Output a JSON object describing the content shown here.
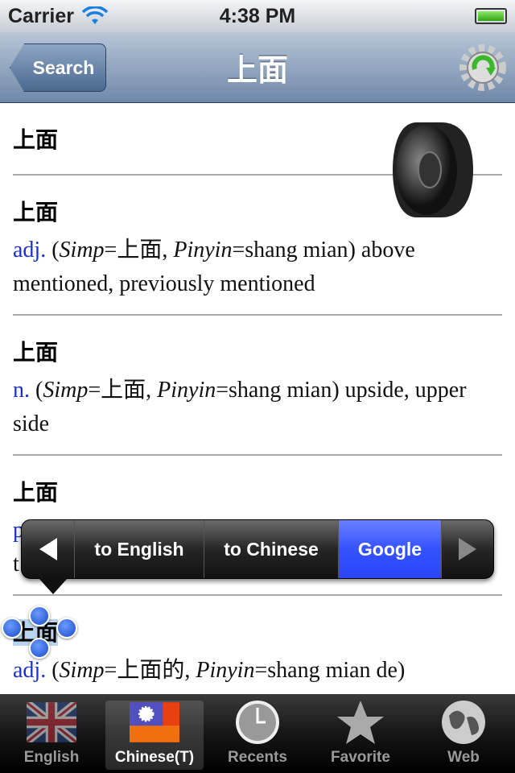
{
  "status": {
    "carrier": "Carrier",
    "time": "4:38 PM"
  },
  "nav": {
    "back_label": "Search",
    "title": "上面"
  },
  "entries": [
    {
      "headword": "上面"
    },
    {
      "headword": "上面",
      "pos": "adj.",
      "simp_label": "Simp",
      "simp": "上面",
      "pinyin_label": "Pinyin",
      "pinyin": "shang mian",
      "gloss": "above mentioned, previously mentioned"
    },
    {
      "headword": "上面",
      "pos": "n.",
      "simp_label": "Simp",
      "simp": "上面",
      "pinyin_label": "Pinyin",
      "pinyin": "shang mian",
      "gloss": "upside, upper side"
    },
    {
      "headword": "上面",
      "line1_fragment": "p",
      "line2_fragment": "t"
    },
    {
      "headword": "上面",
      "pos": "adj.",
      "simp_label": "Simp",
      "simp": "上面的",
      "pinyin_label": "Pinyin",
      "pinyin": "shang mian de"
    }
  ],
  "menu": {
    "items": [
      "to English",
      "to Chinese",
      "Google"
    ],
    "selected": "Google",
    "selected_color": "#3552ff"
  },
  "tabbar": {
    "active": "Chinese(T)",
    "tabs": [
      {
        "label": "English",
        "icon": "uk-flag-icon"
      },
      {
        "label": "Chinese(T)",
        "icon": "taiwan-flag-icon"
      },
      {
        "label": "Recents",
        "icon": "clock-icon"
      },
      {
        "label": "Favorite",
        "icon": "star-icon"
      },
      {
        "label": "Web",
        "icon": "globe-icon"
      }
    ]
  }
}
